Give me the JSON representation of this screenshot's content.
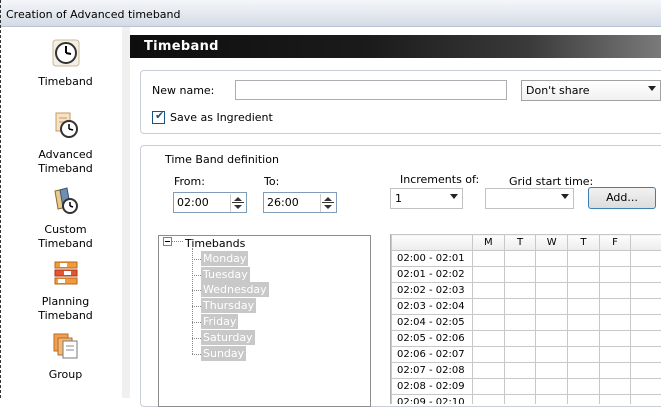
{
  "window": {
    "title": "Creation of Advanced timeband"
  },
  "sidebar": {
    "items": [
      {
        "label": "Timeband",
        "icon": "clock-icon"
      },
      {
        "label": "Advanced\nTimeband",
        "icon": "advanced-clock-icon"
      },
      {
        "label": "Custom\nTimeband",
        "icon": "custom-clock-icon"
      },
      {
        "label": "Planning\nTimeband",
        "icon": "planning-bars-icon"
      },
      {
        "label": "Group",
        "icon": "group-pages-icon"
      }
    ]
  },
  "header": {
    "title": "Timeband"
  },
  "form": {
    "new_name_label": "New name:",
    "new_name_value": "",
    "share_value": "Don't share",
    "save_as_ingredient_label": "Save as Ingredient",
    "save_as_ingredient_checked": true,
    "definition_legend": "Time Band definition",
    "from_label": "From:",
    "from_value": "02:00",
    "to_label": "To:",
    "to_value": "26:00",
    "increments_label": "Increments of:",
    "increments_value": "1",
    "grid_start_label": "Grid start time:",
    "grid_start_value": "",
    "add_button": "Add..."
  },
  "tree": {
    "root": "Timebands",
    "items": [
      "Monday",
      "Tuesday",
      "Wednesday",
      "Thursday",
      "Friday",
      "Saturday",
      "Sunday"
    ]
  },
  "grid": {
    "columns": [
      "M",
      "T",
      "W",
      "T",
      "F"
    ],
    "rows": [
      "02:00 - 02:01",
      "02:01 - 02:02",
      "02:02 - 02:03",
      "02:03 - 02:04",
      "02:04 - 02:05",
      "02:05 - 02:06",
      "02:06 - 02:07",
      "02:07 - 02:08",
      "02:08 - 02:09",
      "02:09 - 02:10"
    ]
  },
  "colors": {
    "header_bar": "#111111",
    "selection_gray": "#c8c8c8",
    "checkbox_blue": "#1c5180",
    "button_border": "#3c7fb1"
  }
}
